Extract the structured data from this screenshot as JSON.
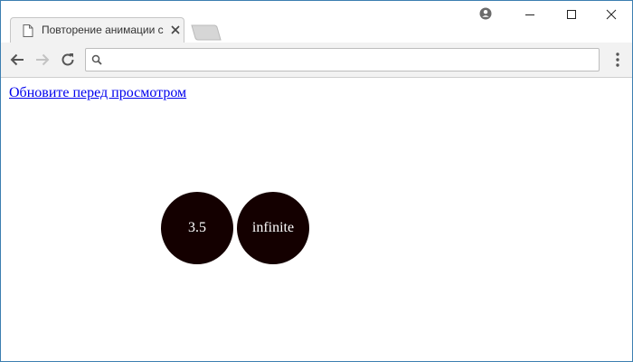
{
  "browser": {
    "tab": {
      "title": "Повторение анимации с",
      "doc_icon": "document-icon",
      "close_icon": "close-icon"
    },
    "new_tab_icon": "new-tab-icon",
    "profile_icon": "profile-icon",
    "window_controls": [
      "minimize-icon",
      "maximize-icon",
      "close-icon"
    ],
    "toolbar": {
      "back_icon": "back-arrow-icon",
      "forward_icon": "forward-arrow-icon",
      "reload_icon": "reload-icon",
      "omnibox": {
        "icon": "search-icon",
        "value": "",
        "placeholder": ""
      },
      "menu_icon": "more-vert-icon"
    },
    "accent_color": "#3c7fb1"
  },
  "page": {
    "refresh_link": "Обновите перед просмотром",
    "circles": [
      {
        "label": "3.5",
        "color": "#140000"
      },
      {
        "label": "infinite",
        "color": "#140000"
      }
    ]
  }
}
